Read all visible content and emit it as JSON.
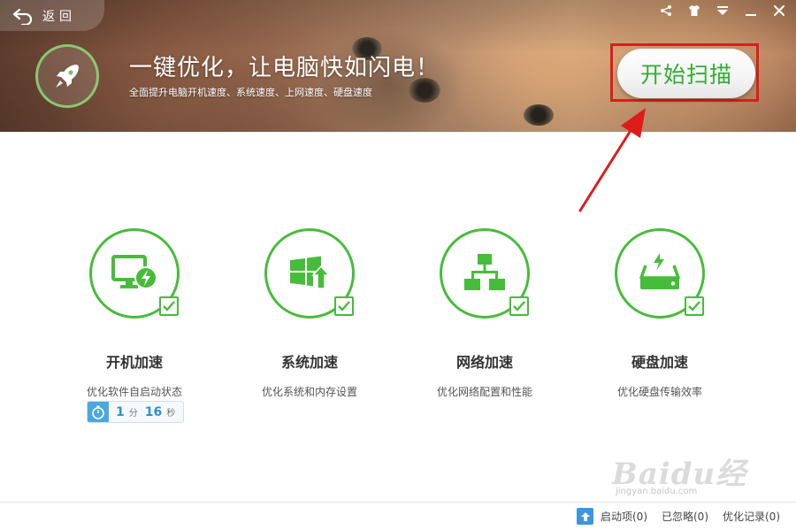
{
  "header": {
    "back_label": "返回",
    "headline": "一键优化，让电脑快如闪电！",
    "subline": "全面提升电脑开机速度、系统速度、上网速度、硬盘速度",
    "scan_button_label": "开始扫描"
  },
  "window_controls": [
    "share-icon",
    "skin-icon",
    "menu-icon",
    "minimize-icon",
    "close-icon"
  ],
  "features": [
    {
      "icon": "monitor-bolt-icon",
      "title": "开机加速",
      "desc": "优化软件自启动状态",
      "checked": true
    },
    {
      "icon": "windows-upgrade-icon",
      "title": "系统加速",
      "desc": "优化系统和内存设置",
      "checked": true
    },
    {
      "icon": "network-icon",
      "title": "网络加速",
      "desc": "优化网络配置和性能",
      "checked": true
    },
    {
      "icon": "disk-bolt-icon",
      "title": "硬盘加速",
      "desc": "优化硬盘传输效率",
      "checked": true
    }
  ],
  "boot_timer": {
    "minutes": "1",
    "minutes_unit": "分",
    "seconds": "16",
    "seconds_unit": "秒"
  },
  "footer": {
    "startup_items": "启动项(0)",
    "ignored": "已忽略(0)",
    "history": "优化记录(0)"
  },
  "watermark": {
    "text": "Baidu经验",
    "url": "jingyan.baidu.com"
  },
  "colors": {
    "accent_green": "#46bd3a",
    "scan_text_green": "#2fae2f",
    "highlight_red": "#e01b1b",
    "timer_blue": "#2d8fd1"
  }
}
